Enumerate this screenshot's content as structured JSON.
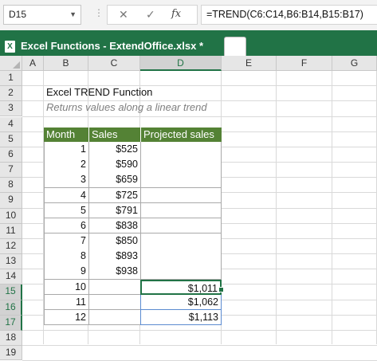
{
  "formula_bar": {
    "name_box": "D15",
    "formula": "=TREND(C6:C14,B6:B14,B15:B17)",
    "icons": [
      "chevron-down-icon",
      "cancel-icon",
      "enter-icon",
      "insert-function-icon"
    ]
  },
  "tab": {
    "label": "Excel Functions - ExtendOffice.xlsx *",
    "icon": "excel-file-icon"
  },
  "columns": [
    "A",
    "B",
    "C",
    "D",
    "E",
    "F",
    "G"
  ],
  "rows": [
    "1",
    "2",
    "3",
    "4",
    "5",
    "6",
    "7",
    "8",
    "9",
    "10",
    "11",
    "12",
    "13",
    "14",
    "15",
    "16",
    "17",
    "18",
    "19"
  ],
  "sheet": {
    "title": "Excel TREND Function",
    "subtitle": "Returns values along a linear trend",
    "headers": [
      "Month",
      "Sales",
      "Projected sales"
    ],
    "data": [
      {
        "month": "1",
        "sales": "$525",
        "proj": ""
      },
      {
        "month": "2",
        "sales": "$590",
        "proj": ""
      },
      {
        "month": "3",
        "sales": "$659",
        "proj": ""
      },
      {
        "month": "4",
        "sales": "$725",
        "proj": ""
      },
      {
        "month": "5",
        "sales": "$791",
        "proj": ""
      },
      {
        "month": "6",
        "sales": "$838",
        "proj": ""
      },
      {
        "month": "7",
        "sales": "$850",
        "proj": ""
      },
      {
        "month": "8",
        "sales": "$893",
        "proj": ""
      },
      {
        "month": "9",
        "sales": "$938",
        "proj": ""
      },
      {
        "month": "10",
        "sales": "",
        "proj": "$1,011"
      },
      {
        "month": "11",
        "sales": "",
        "proj": "$1,062"
      },
      {
        "month": "12",
        "sales": "",
        "proj": "$1,113"
      }
    ]
  },
  "colors": {
    "accent": "#217346",
    "header_fill": "#548235"
  }
}
